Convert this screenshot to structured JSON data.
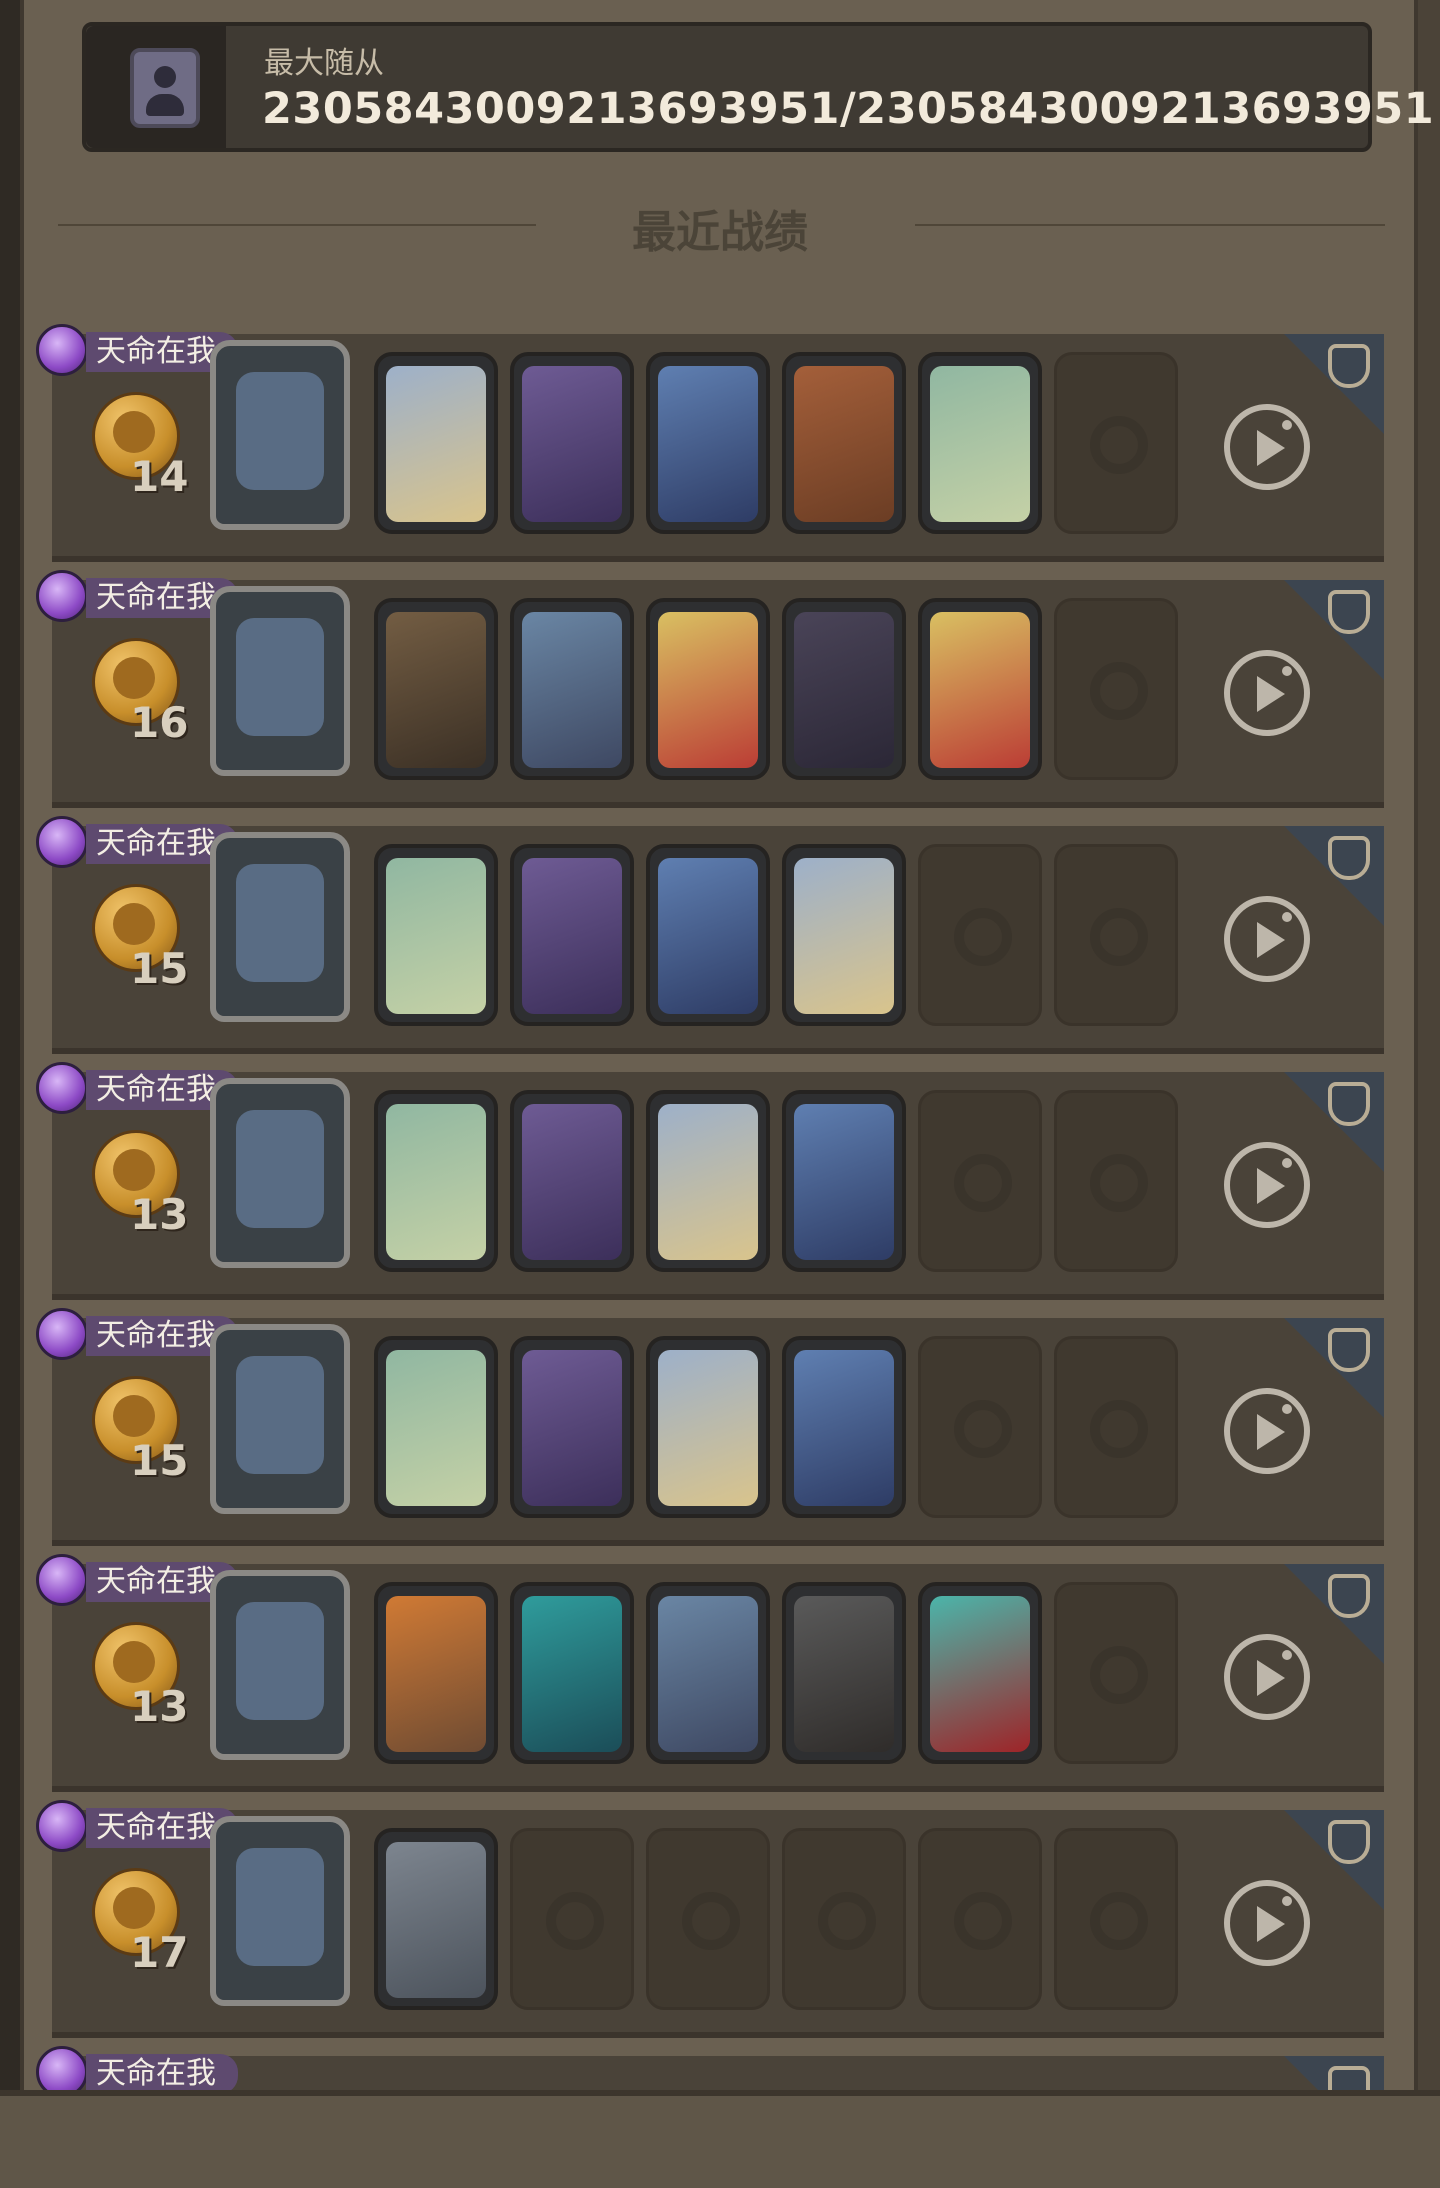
{
  "header": {
    "icon": "profile-icon",
    "label": "最大随从",
    "value": "2305843009213693951/2305843009213693951"
  },
  "section": {
    "title": "最近战绩"
  },
  "records": [
    {
      "tag": "天命在我",
      "count": "14",
      "leader_icon": "leader-portrait",
      "units": [
        "king",
        "witch",
        "mage",
        "archer",
        "goat",
        "empty"
      ]
    },
    {
      "tag": "天命在我",
      "count": "16",
      "leader_icon": "leader-portrait",
      "units": [
        "hat-wizard",
        "dark-elf",
        "puppet",
        "dragon",
        "puppet",
        "empty"
      ]
    },
    {
      "tag": "天命在我",
      "count": "15",
      "leader_icon": "leader-portrait",
      "units": [
        "goat",
        "witch",
        "mage",
        "king",
        "empty",
        "empty"
      ]
    },
    {
      "tag": "天命在我",
      "count": "13",
      "leader_icon": "leader-portrait",
      "units": [
        "goat",
        "witch",
        "king",
        "mage",
        "empty",
        "empty"
      ]
    },
    {
      "tag": "天命在我",
      "count": "15",
      "leader_icon": "leader-portrait",
      "units": [
        "goat",
        "witch",
        "king",
        "mage",
        "empty",
        "empty"
      ]
    },
    {
      "tag": "天命在我",
      "count": "13",
      "leader_icon": "leader-portrait",
      "units": [
        "pumpkins",
        "wolf",
        "dark-elf",
        "hooded-rogue",
        "spirit",
        "empty"
      ]
    },
    {
      "tag": "天命在我",
      "count": "17",
      "leader_icon": "leader-portrait",
      "units": [
        "knight",
        "empty",
        "empty",
        "empty",
        "empty",
        "empty"
      ]
    },
    {
      "tag": "天命在我",
      "count": "",
      "leader_icon": "leader-portrait",
      "units": []
    }
  ]
}
